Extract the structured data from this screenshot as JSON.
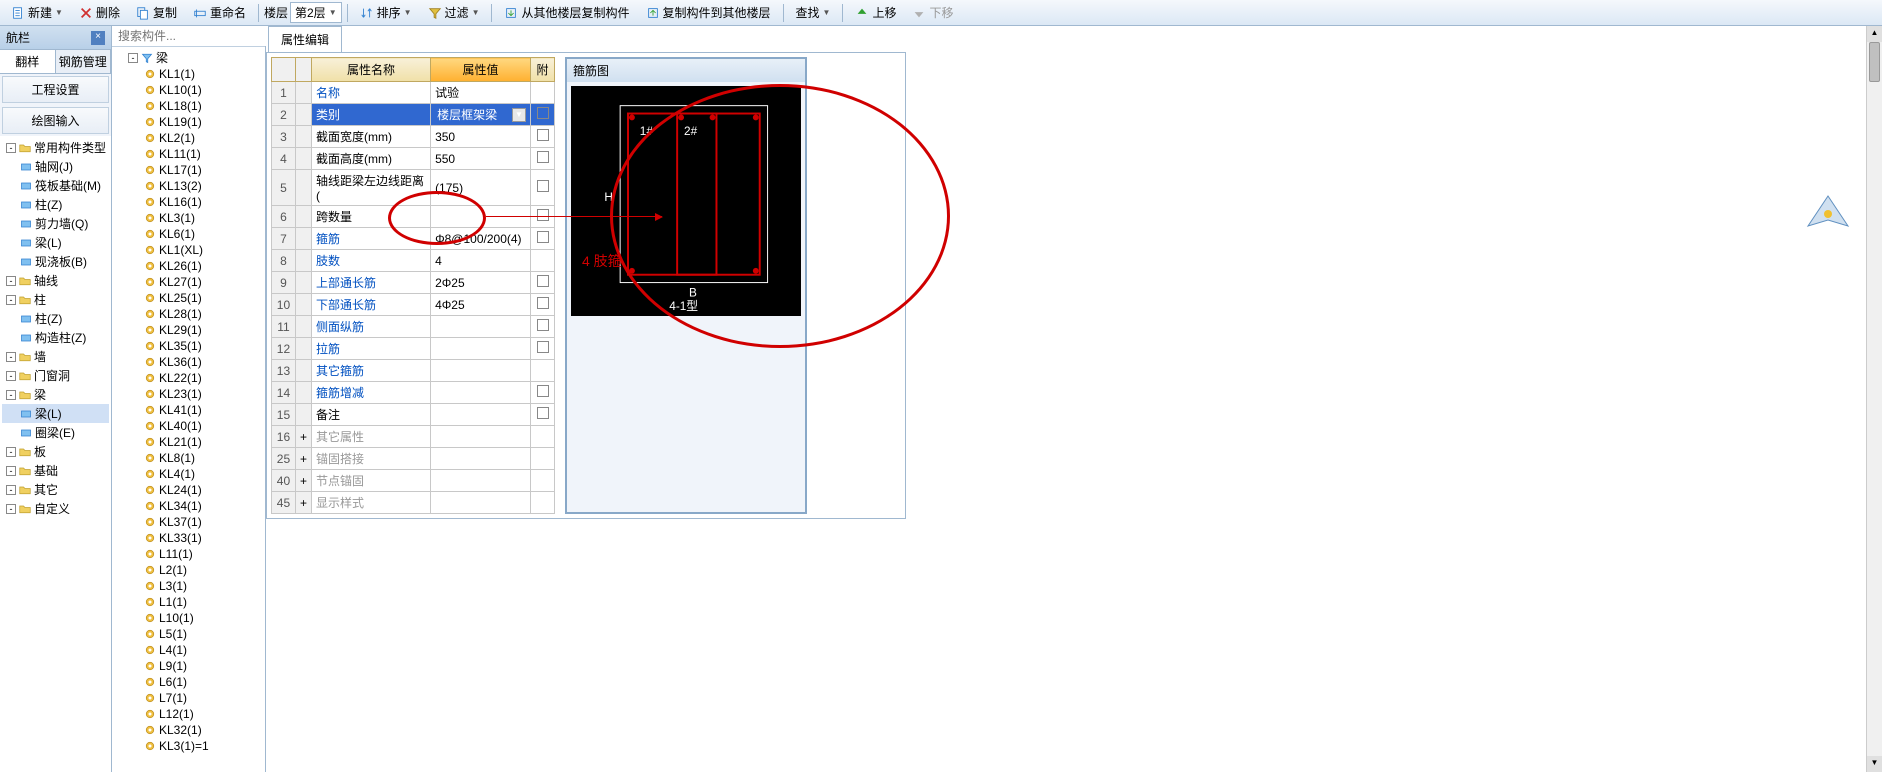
{
  "toolbar": {
    "new": "新建",
    "delete": "删除",
    "copy": "复制",
    "rename": "重命名",
    "floor": "楼层",
    "floor_sel": "第2层",
    "sort": "排序",
    "filter": "过滤",
    "copy_from": "从其他楼层复制构件",
    "copy_to": "复制构件到其他楼层",
    "find": "查找",
    "up": "上移",
    "down": "下移"
  },
  "left": {
    "title": "航栏",
    "tabs": [
      "翻样",
      "钢筋管理"
    ],
    "btns": [
      "工程设置",
      "绘图输入"
    ],
    "tree": [
      {
        "label": "常用构件类型",
        "children": [
          {
            "label": "轴网(J)",
            "icon": "grid"
          },
          {
            "label": "筏板基础(M)",
            "icon": "raft"
          },
          {
            "label": "柱(Z)",
            "icon": "col"
          },
          {
            "label": "剪力墙(Q)",
            "icon": "wall"
          },
          {
            "label": "梁(L)",
            "icon": "beam"
          },
          {
            "label": "现浇板(B)",
            "icon": "slab"
          }
        ]
      },
      {
        "label": "轴线",
        "children": []
      },
      {
        "label": "柱",
        "children": [
          {
            "label": "柱(Z)",
            "icon": "col"
          },
          {
            "label": "构造柱(Z)",
            "icon": "col"
          }
        ]
      },
      {
        "label": "墙",
        "children": []
      },
      {
        "label": "门窗洞",
        "children": []
      },
      {
        "label": "梁",
        "children": [
          {
            "label": "梁(L)",
            "icon": "beam",
            "sel": true
          },
          {
            "label": "圈梁(E)",
            "icon": "ring"
          }
        ]
      },
      {
        "label": "板",
        "children": []
      },
      {
        "label": "基础",
        "children": []
      },
      {
        "label": "其它",
        "children": []
      },
      {
        "label": "自定义",
        "children": []
      }
    ]
  },
  "mid": {
    "search_ph": "搜索构件...",
    "root": "梁",
    "items": [
      "KL1(1)",
      "KL10(1)",
      "KL18(1)",
      "KL19(1)",
      "KL2(1)",
      "KL11(1)",
      "KL17(1)",
      "KL13(2)",
      "KL16(1)",
      "KL3(1)",
      "KL6(1)",
      "KL1(XL)",
      "KL26(1)",
      "KL27(1)",
      "KL25(1)",
      "KL28(1)",
      "KL29(1)",
      "KL35(1)",
      "KL36(1)",
      "KL22(1)",
      "KL23(1)",
      "KL41(1)",
      "KL40(1)",
      "KL21(1)",
      "KL8(1)",
      "KL4(1)",
      "KL24(1)",
      "KL34(1)",
      "KL37(1)",
      "KL33(1)",
      "L11(1)",
      "L2(1)",
      "L3(1)",
      "L1(1)",
      "L10(1)",
      "L5(1)",
      "L4(1)",
      "L9(1)",
      "L6(1)",
      "L7(1)",
      "L12(1)",
      "KL32(1)",
      "KL3(1)=1"
    ]
  },
  "prop": {
    "tab": "属性编辑",
    "headers": {
      "name": "属性名称",
      "value": "属性值",
      "att": "附"
    },
    "rows": [
      {
        "n": "1",
        "name": "名称",
        "val": "试验",
        "link": true
      },
      {
        "n": "2",
        "name": "类别",
        "val": "楼层框架梁",
        "link": true,
        "sel": true,
        "dd": true,
        "chk": true
      },
      {
        "n": "3",
        "name": "截面宽度(mm)",
        "val": "350",
        "chk": true
      },
      {
        "n": "4",
        "name": "截面高度(mm)",
        "val": "550",
        "chk": true
      },
      {
        "n": "5",
        "name": "轴线距梁左边线距离(",
        "val": "(175)",
        "chk": true
      },
      {
        "n": "6",
        "name": "跨数量",
        "val": "",
        "chk": true
      },
      {
        "n": "7",
        "name": "箍筋",
        "val": "Φ8@100/200(4)",
        "link": true,
        "chk": true
      },
      {
        "n": "8",
        "name": "肢数",
        "val": "4",
        "link": true
      },
      {
        "n": "9",
        "name": "上部通长筋",
        "val": "2Φ25",
        "link": true,
        "chk": true
      },
      {
        "n": "10",
        "name": "下部通长筋",
        "val": "4Φ25",
        "link": true,
        "chk": true
      },
      {
        "n": "11",
        "name": "侧面纵筋",
        "val": "",
        "link": true,
        "chk": true
      },
      {
        "n": "12",
        "name": "拉筋",
        "val": "",
        "link": true,
        "chk": true
      },
      {
        "n": "13",
        "name": "其它箍筋",
        "val": "",
        "link": true
      },
      {
        "n": "14",
        "name": "箍筋增减",
        "val": "",
        "link": true,
        "chk": true
      },
      {
        "n": "15",
        "name": "备注",
        "val": "",
        "chk": true
      },
      {
        "n": "16",
        "name": "其它属性",
        "val": "",
        "gray": true,
        "exp": "+"
      },
      {
        "n": "25",
        "name": "锚固搭接",
        "val": "",
        "gray": true,
        "exp": "+"
      },
      {
        "n": "40",
        "name": "节点锚固",
        "val": "",
        "gray": true,
        "exp": "+"
      },
      {
        "n": "45",
        "name": "显示样式",
        "val": "",
        "gray": true,
        "exp": "+"
      }
    ]
  },
  "diagram": {
    "title": "箍筋图",
    "labels": {
      "h": "H",
      "b": "B",
      "n1": "1#",
      "n2": "2#",
      "bottom": "4-1型"
    }
  },
  "annotation": "4 肢箍"
}
